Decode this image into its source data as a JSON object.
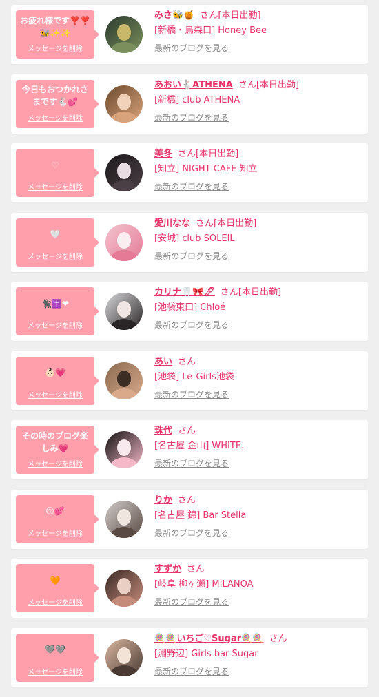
{
  "colors": {
    "accent_pink": "#ff9fac",
    "name_pink": "#e8336a",
    "link_gray": "#888888",
    "background": "#efefef"
  },
  "favorites": [
    {
      "message": "お疲れ様です❣️❣️🐝✨✨",
      "delete_label": "メッセージを削除",
      "name": "みさ🐝🍯",
      "suffix": "さん",
      "status": "[本日出勤]",
      "shop": "[新橋・烏森口] Honey Bee",
      "blog_link": "最新のブログを見る",
      "avatar_colors": [
        "#2b3a2f",
        "#7a8f5c",
        "#c9b86a"
      ]
    },
    {
      "message": "今日もおつかれさまです🐇💕",
      "delete_label": "メッセージを削除",
      "name": "あおい🐇ATHENA",
      "suffix": "さん",
      "status": "[本日出勤]",
      "shop": "[新橋] club ATHENA",
      "blog_link": "最新のブログを見る",
      "avatar_colors": [
        "#6b4a2e",
        "#d8a27a",
        "#f2d2b8"
      ]
    },
    {
      "message": "♡",
      "delete_label": "メッセージを削除",
      "name": "美冬",
      "suffix": "さん",
      "status": "[本日出勤]",
      "shop": "[知立] NIGHT CAFE 知立",
      "blog_link": "最新のブログを見る",
      "avatar_colors": [
        "#1d1a1c",
        "#4a3f44",
        "#e8dde2"
      ]
    },
    {
      "message": "🤍",
      "delete_label": "メッセージを削除",
      "name": "愛川なな",
      "suffix": "さん",
      "status": "[本日出勤]",
      "shop": "[安城] club SOLEIL",
      "blog_link": "最新のブログを見る",
      "avatar_colors": [
        "#f3c4cf",
        "#e47a96",
        "#fbeef1"
      ]
    },
    {
      "message": "🐈‍⬛✝️❤",
      "delete_label": "メッセージを削除",
      "name": "カリナ🦷🎀🖋",
      "suffix": "さん",
      "status": "[本日出勤]",
      "shop": "[池袋東口] Chloé",
      "blog_link": "最新のブログを見る",
      "avatar_colors": [
        "#d7d7d9",
        "#2a2526",
        "#f0e6e3"
      ]
    },
    {
      "message": "👶🏻💗",
      "delete_label": "メッセージを削除",
      "name": "あい",
      "suffix": "さん",
      "status": "",
      "shop": "[池袋] Le-Girls池袋",
      "blog_link": "最新のブログを見る",
      "avatar_colors": [
        "#8a6a50",
        "#d9a98a",
        "#3b2c24"
      ]
    },
    {
      "message": "その時のブログ楽しみ💗",
      "delete_label": "メッセージを削除",
      "name": "珠代",
      "suffix": "さん",
      "status": "",
      "shop": "[名古屋 金山] WHITE.",
      "blog_link": "最新のブログを見る",
      "avatar_colors": [
        "#111111",
        "#f4b8c8",
        "#f8e9ee"
      ]
    },
    {
      "message": "😚💕",
      "delete_label": "メッセージを削除",
      "name": "りか",
      "suffix": "さん",
      "status": "",
      "shop": "[名古屋 錦] Bar Stella",
      "blog_link": "最新のブログを見る",
      "avatar_colors": [
        "#cfcac8",
        "#5a4a44",
        "#efe6e0"
      ]
    },
    {
      "message": "🧡",
      "delete_label": "メッセージを削除",
      "name": "すずか",
      "suffix": "さん",
      "status": "",
      "shop": "[岐阜 柳ヶ瀬] MILANOA",
      "blog_link": "最新のブログを見る",
      "avatar_colors": [
        "#3a2a26",
        "#c58b7a",
        "#e9cfc4"
      ]
    },
    {
      "message": "🩶🩶",
      "delete_label": "メッセージを削除",
      "name": "🍭🍭いちご♡Sugar🍭🍭",
      "suffix": "さん",
      "status": "",
      "shop": "[淵野辺] Girls bar Sugar",
      "blog_link": "最新のブログを見る",
      "avatar_colors": [
        "#d9b7a0",
        "#4a3a33",
        "#f3e2d6"
      ]
    }
  ]
}
